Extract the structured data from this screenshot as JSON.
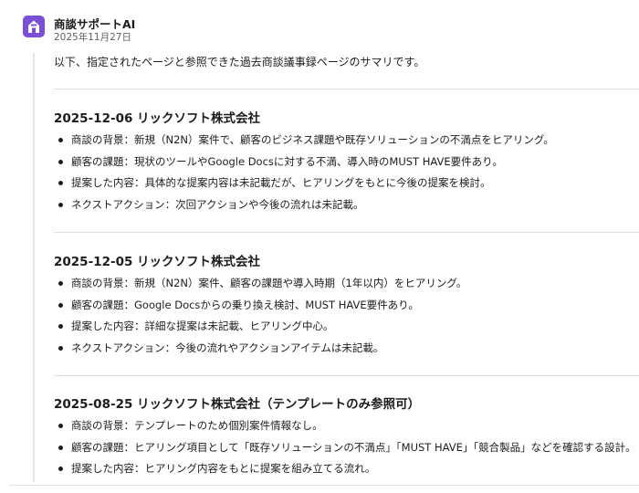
{
  "message": {
    "sender": "商談サポートAI",
    "date": "2025年11月27日",
    "intro": "以下、指定されたページと参照できた過去商談議事録ページのサマリです。",
    "sections": [
      {
        "title": "2025-12-06 リックソフト株式会社",
        "items": [
          "商談の背景：新規（N2N）案件で、顧客のビジネス課題や既存ソリューションの不満点をヒアリング。",
          "顧客の課題：現状のツールやGoogle Docsに対する不満、導入時のMUST HAVE要件あり。",
          "提案した内容：具体的な提案内容は未記載だが、ヒアリングをもとに今後の提案を検討。",
          "ネクストアクション：次回アクションや今後の流れは未記載。"
        ]
      },
      {
        "title": "2025-12-05 リックソフト株式会社",
        "items": [
          "商談の背景：新規（N2N）案件、顧客の課題や導入時期（1年以内）をヒアリング。",
          "顧客の課題：Google Docsからの乗り換え検討、MUST HAVE要件あり。",
          "提案した内容：詳細な提案は未記載、ヒアリング中心。",
          "ネクストアクション：今後の流れやアクションアイテムは未記載。"
        ]
      },
      {
        "title": "2025-08-25 リックソフト株式会社（テンプレートのみ参照可）",
        "items": [
          "商談の背景：テンプレートのため個別案件情報なし。",
          "顧客の課題：ヒアリング項目として「既存ソリューションの不満点」「MUST HAVE」「競合製品」などを確認する設計。",
          "提案した内容：ヒアリング内容をもとに提案を組み立てる流れ。"
        ]
      }
    ]
  },
  "colors": {
    "avatar_bg": "#7b4fd6",
    "text": "#1d1c1d",
    "muted": "#616061"
  }
}
